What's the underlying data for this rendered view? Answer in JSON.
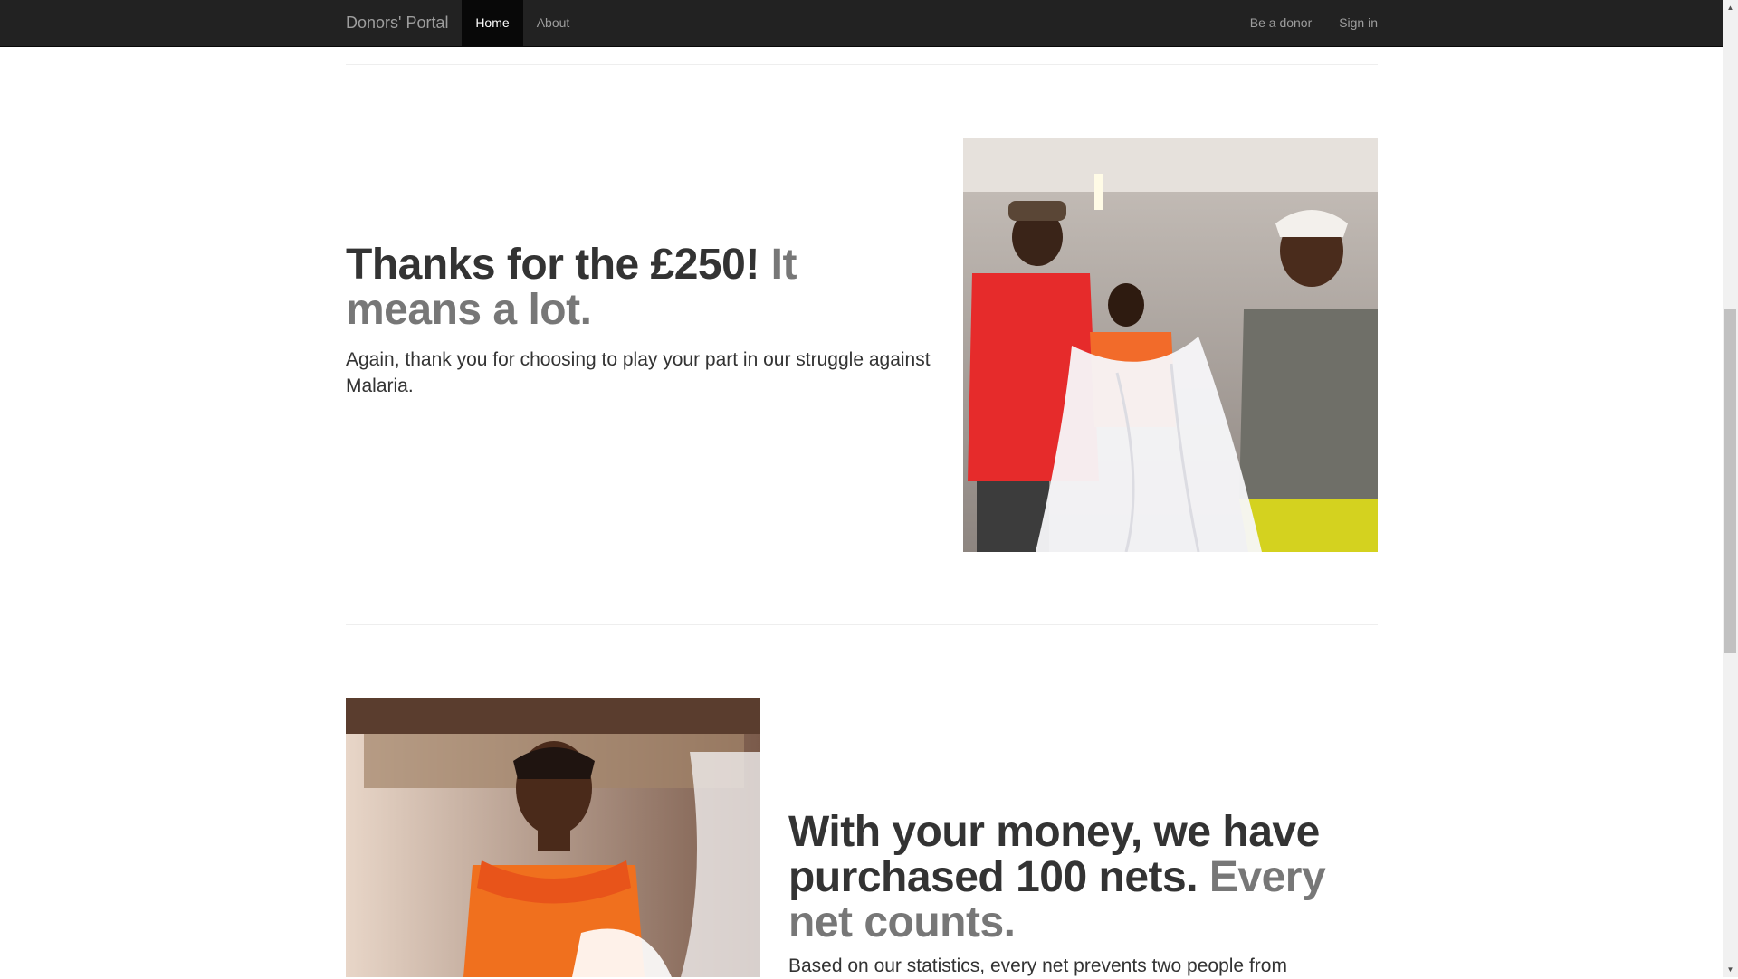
{
  "navbar": {
    "brand": "Donors' Portal",
    "items": [
      {
        "label": "Home",
        "active": true
      },
      {
        "label": "About",
        "active": false
      }
    ],
    "right_items": [
      {
        "label": "Be a donor"
      },
      {
        "label": "Sign in"
      }
    ]
  },
  "feature1": {
    "heading_main": "Thanks for the £250!",
    "heading_muted": "It means a lot.",
    "lead": "Again, thank you for choosing to play your part in our struggle against Malaria."
  },
  "feature2": {
    "heading_main": "With your money, we have purchased 100 nets.",
    "heading_muted": "Every net counts.",
    "lead": "Based on our statistics, every net prevents two people from"
  },
  "colors": {
    "navbar_bg": "#222222",
    "nav_active_bg": "#080808",
    "muted_text": "#777777"
  }
}
